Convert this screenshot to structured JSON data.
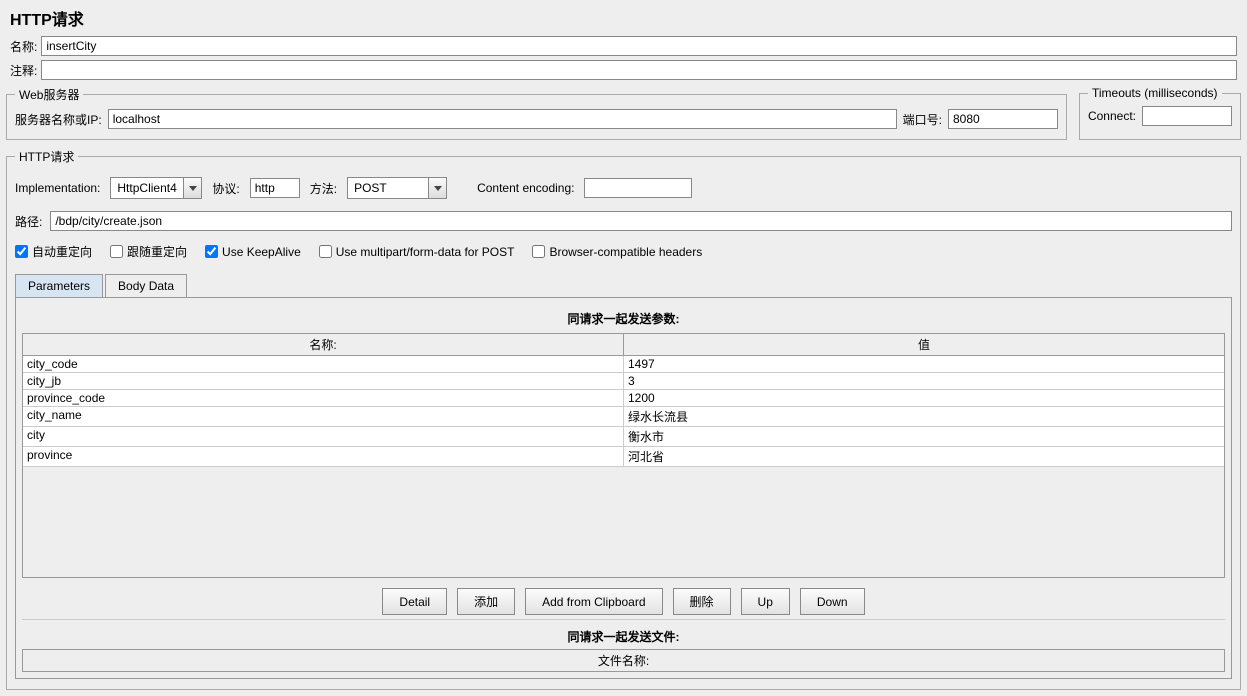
{
  "title": "HTTP请求",
  "name_label": "名称:",
  "name_value": "insertCity",
  "comment_label": "注释:",
  "comment_value": "",
  "web_server": {
    "legend": "Web服务器",
    "server_label": "服务器名称或IP:",
    "server_value": "localhost",
    "port_label": "端口号:",
    "port_value": "8080"
  },
  "timeouts": {
    "legend": "Timeouts (milliseconds)",
    "connect_label": "Connect:",
    "connect_value": ""
  },
  "http_request": {
    "legend": "HTTP请求",
    "impl_label": "Implementation:",
    "impl_value": "HttpClient4",
    "proto_label": "协议:",
    "proto_value": "http",
    "method_label": "方法:",
    "method_value": "POST",
    "enc_label": "Content encoding:",
    "enc_value": "",
    "path_label": "路径:",
    "path_value": "/bdp/city/create.json"
  },
  "checks": {
    "auto_redirect": "自动重定向",
    "follow_redirect": "跟随重定向",
    "keepalive": "Use KeepAlive",
    "multipart": "Use multipart/form-data for POST",
    "browser_compat": "Browser-compatible headers"
  },
  "tabs": {
    "parameters": "Parameters",
    "body_data": "Body Data"
  },
  "params_section": {
    "title": "同请求一起发送参数:",
    "header_name": "名称:",
    "header_value": "值",
    "rows": [
      {
        "name": "city_code",
        "value": "1497"
      },
      {
        "name": "city_jb",
        "value": "3"
      },
      {
        "name": "province_code",
        "value": "1200"
      },
      {
        "name": "city_name",
        "value": "绿水长流县"
      },
      {
        "name": "city",
        "value": "衡水市"
      },
      {
        "name": "province",
        "value": "河北省"
      }
    ]
  },
  "buttons": {
    "detail": "Detail",
    "add": "添加",
    "add_clipboard": "Add from Clipboard",
    "delete": "删除",
    "up": "Up",
    "down": "Down"
  },
  "files_section": {
    "title": "同请求一起发送文件:",
    "header": "文件名称:"
  }
}
